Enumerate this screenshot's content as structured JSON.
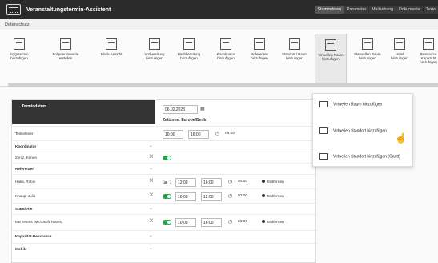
{
  "window": {
    "title": "Veranstaltungstermin-Assistent",
    "top_tabs": [
      "Stammdaten",
      "Parameter",
      "Mailanhang",
      "Dokumente",
      "Texte"
    ],
    "active_tab_index": 0
  },
  "subheader": "Datenschutz",
  "ribbon": [
    {
      "label": "Folgetermin hinzufügen"
    },
    {
      "label": "Folgeterminserie erstellen"
    },
    {
      "label": "Block-Ansicht"
    },
    {
      "label": "Vorbereitung hinzufügen"
    },
    {
      "label": "Nachbereitung hinzufügen"
    },
    {
      "label": "Koordinator hinzufügen"
    },
    {
      "label": "Referenten hinzufügen"
    },
    {
      "label": "Standort / Raum hinzufügen"
    },
    {
      "label": "Virtuellen Raum hinzufügen"
    },
    {
      "label": "Manuellen Raum hinzufügen"
    },
    {
      "label": "Hotel hinzufügen"
    },
    {
      "label": "Ressource Kapazität hinzufügen"
    }
  ],
  "termin": {
    "header": "Termindatum",
    "date": "06.02.2023",
    "timezone": "Zeitzone: Europe/Berlin",
    "teilnehmer_label": "Teilnehmer",
    "teilnehmer_start": "10:00",
    "teilnehmer_end": "16:00",
    "teilnehmer_duration": "06:00"
  },
  "sections": {
    "koordinator": "Koordinator",
    "referenten": "Referenten",
    "standorte": "Standorte",
    "kapazitaet": "Kapazität-Ressource",
    "mobile": "Mobile"
  },
  "rows": {
    "koordinator_name": "Zimtz, Kenen",
    "ref1": {
      "name": "Haka, Robin",
      "start": "12:00",
      "end": "16:00",
      "duration": "04:00",
      "remove": "Entfernen"
    },
    "ref2": {
      "name": "Knaup, Julia",
      "start": "10:00",
      "end": "12:00",
      "duration": "02:00",
      "remove": "Entfernen"
    },
    "standort": {
      "name": "MB Teams (Microsoft Teams)",
      "start": "10:00",
      "end": "16:00",
      "duration": "06:00",
      "remove": "Entfernen"
    }
  },
  "dropdown": [
    "Virtuellen Raum hinzufügen",
    "Virtuellen Standort hinzufügen",
    "Virtuellen Standort hinzufügen (Gantt)"
  ]
}
